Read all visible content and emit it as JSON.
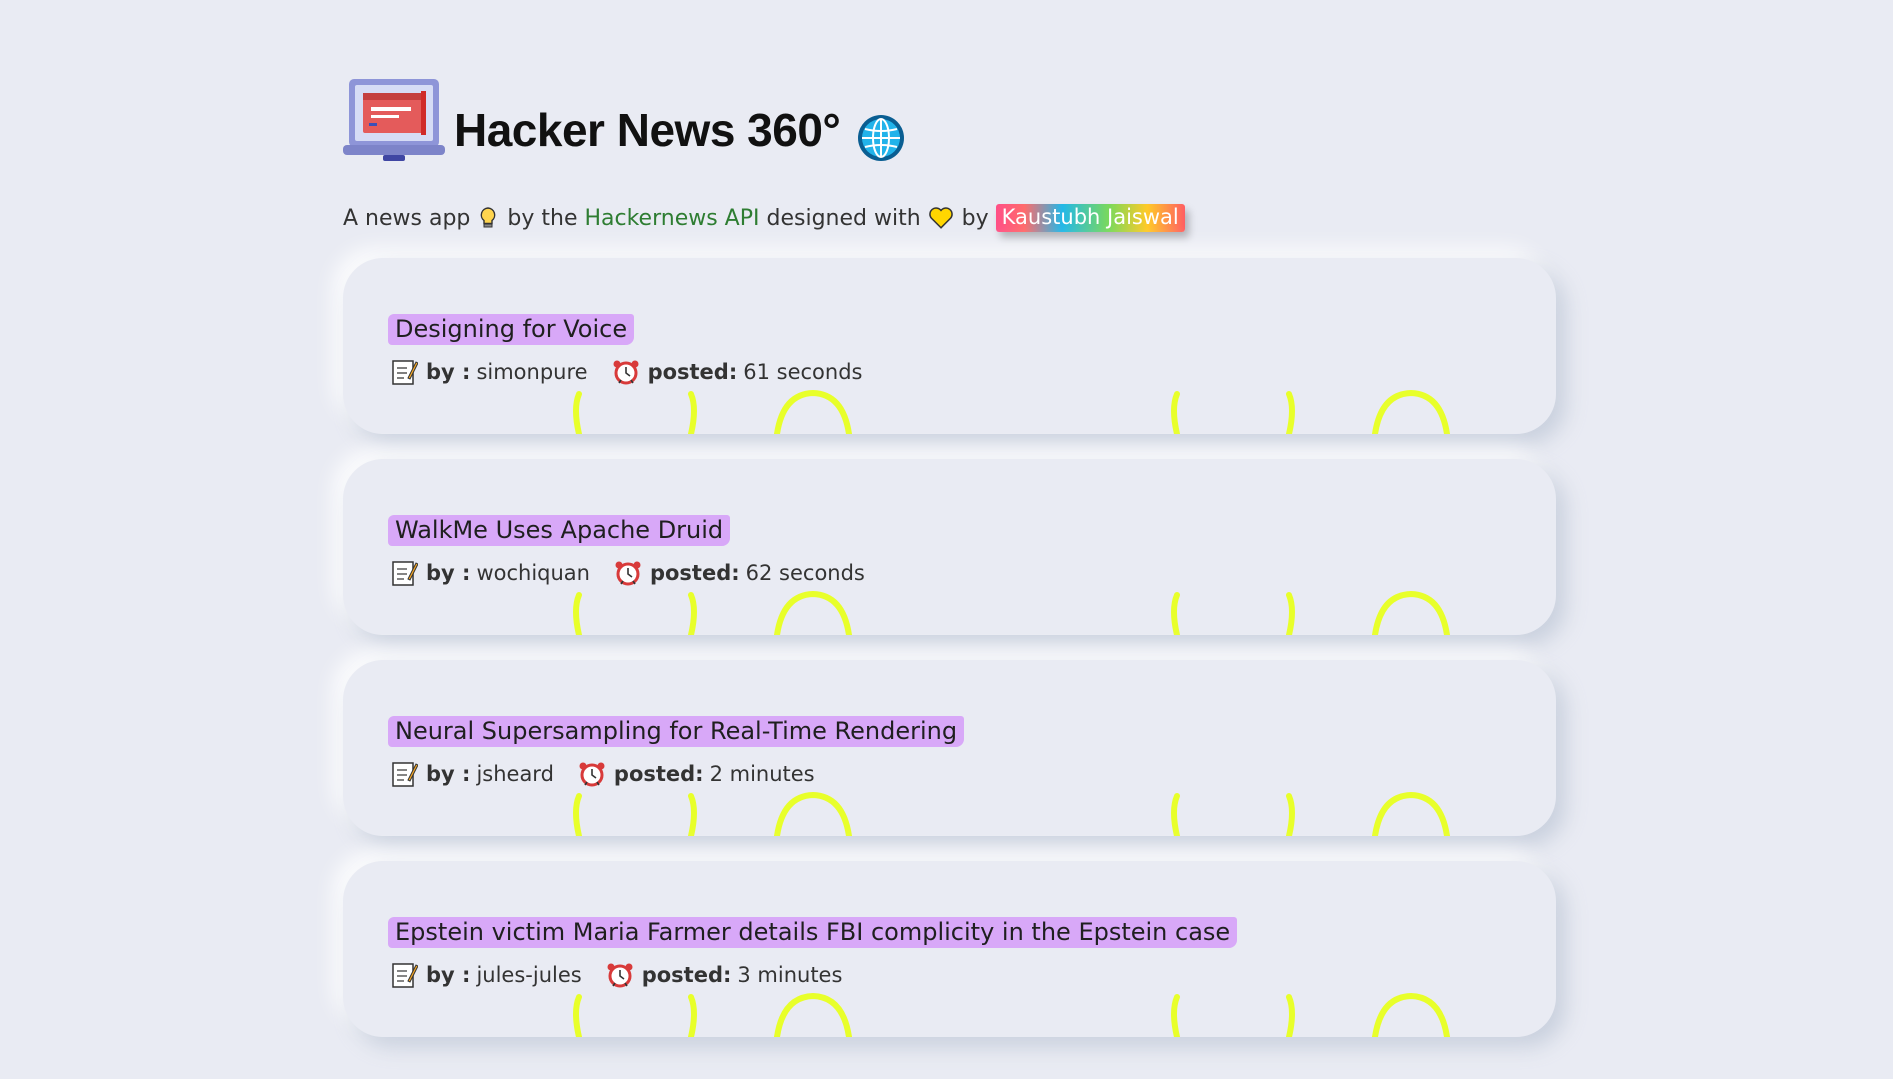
{
  "header": {
    "title": "Hacker News 360°",
    "logo_icon": "laptop-icon",
    "globe_icon": "globe-icon"
  },
  "subtitle": {
    "part1": "A news app",
    "part2": "by the",
    "link": "Hackernews API",
    "part3": "designed with",
    "part4": "by",
    "author": "Kaustubh Jaiswal"
  },
  "labels": {
    "by": "by :",
    "posted": "posted:"
  },
  "stories": [
    {
      "title": "Designing for Voice",
      "author": "simonpure",
      "time": "61 seconds"
    },
    {
      "title": "WalkMe Uses Apache Druid",
      "author": "wochiquan",
      "time": "62 seconds"
    },
    {
      "title": "Neural Supersampling for Real-Time Rendering",
      "author": "jsheard",
      "time": "2 minutes"
    },
    {
      "title": "Epstein victim Maria Farmer details FBI complicity in the Epstein case",
      "author": "jules-jules",
      "time": "3 minutes"
    }
  ],
  "colors": {
    "background": "#e9ebf3",
    "title_highlight": "#d8a8f8",
    "link": "#2e7d32",
    "decoration": "#e8ff2a"
  }
}
